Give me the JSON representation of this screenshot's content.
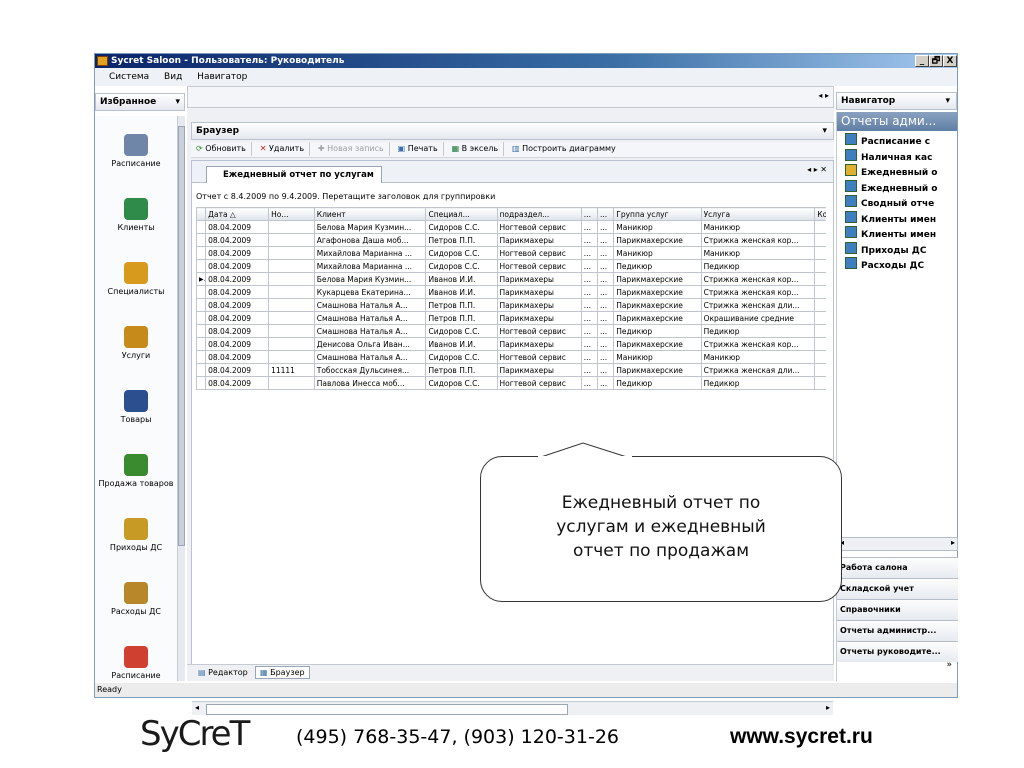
{
  "window": {
    "title": "Sycret Saloon - Пользователь: Руководитель",
    "controls": [
      "_",
      "🗗",
      "X"
    ]
  },
  "menu": [
    "Система",
    "Вид",
    "Навигатор"
  ],
  "favorites": {
    "header": "Избранное"
  },
  "left_nav": [
    {
      "label": "Расписание",
      "icon": "calendar-clock-icon"
    },
    {
      "label": "Клиенты",
      "icon": "client-card-icon"
    },
    {
      "label": "Специалисты",
      "icon": "people-icon"
    },
    {
      "label": "Услуги",
      "icon": "services-book-icon"
    },
    {
      "label": "Товары",
      "icon": "goods-pyramid-icon"
    },
    {
      "label": "Продажа товаров",
      "icon": "sale-person-icon"
    },
    {
      "label": "Приходы ДС",
      "icon": "money-bag-icon"
    },
    {
      "label": "Расходы ДС",
      "icon": "money-bag-out-icon"
    },
    {
      "label": "Расписание",
      "icon": "calendar-12-icon"
    }
  ],
  "browser": {
    "header": "Браузер",
    "toolbar": [
      "Обновить",
      "Удалить",
      "Новая запись",
      "Печать",
      "В эксель",
      "Построить диаграмму"
    ],
    "tab": "Ежедневный отчет по услугам",
    "info": "Отчет с 8.4.2009 по 9.4.2009. Перетащите заголовок для группировки",
    "columns": [
      "Дата  △",
      "Но...",
      "Клиент",
      "Специал...",
      "подраздел...",
      "...",
      "...",
      "Группа услуг",
      "Услуга",
      "Кол-в"
    ],
    "rows": [
      [
        "08.04.2009",
        "",
        "Белова Мария Кузмин...",
        "Сидоров С.С.",
        "Ногтевой сервис",
        "...",
        "...",
        "Маникюр",
        "Маникюр",
        ""
      ],
      [
        "08.04.2009",
        "",
        "Агафонова Даша моб...",
        "Петров П.П.",
        "Парикмахеры",
        "...",
        "...",
        "Парикмахерские",
        "Стрижка женская кор...",
        ""
      ],
      [
        "08.04.2009",
        "",
        "Михайлова Марианна ...",
        "Сидоров С.С.",
        "Ногтевой сервис",
        "...",
        "...",
        "Маникюр",
        "Маникюр",
        ""
      ],
      [
        "08.04.2009",
        "",
        "Михайлова Марианна ...",
        "Сидоров С.С.",
        "Ногтевой сервис",
        "...",
        "...",
        "Педикюр",
        "Педикюр",
        ""
      ],
      [
        "08.04.2009",
        "",
        "Белова Мария Кузмин...",
        "Иванов И.И.",
        "Парикмахеры",
        "...",
        "...",
        "Парикмахерские",
        "Стрижка женская кор...",
        ""
      ],
      [
        "08.04.2009",
        "",
        "Кукарцева Екатерина...",
        "Иванов И.И.",
        "Парикмахеры",
        "...",
        "...",
        "Парикмахерские",
        "Стрижка женская кор...",
        ""
      ],
      [
        "08.04.2009",
        "",
        "Смашнова Наталья А...",
        "Петров П.П.",
        "Парикмахеры",
        "...",
        "...",
        "Парикмахерские",
        "Стрижка женская дли...",
        ""
      ],
      [
        "08.04.2009",
        "",
        "Смашнова Наталья А...",
        "Петров П.П.",
        "Парикмахеры",
        "...",
        "...",
        "Парикмахерские",
        "Окрашивание средние",
        ""
      ],
      [
        "08.04.2009",
        "",
        "Смашнова Наталья А...",
        "Сидоров С.С.",
        "Ногтевой сервис",
        "...",
        "...",
        "Педикюр",
        "Педикюр",
        ""
      ],
      [
        "08.04.2009",
        "",
        "Денисова Ольга Иван...",
        "Иванов И.И.",
        "Парикмахеры",
        "...",
        "...",
        "Парикмахерские",
        "Стрижка женская кор...",
        ""
      ],
      [
        "08.04.2009",
        "",
        "Смашнова Наталья А...",
        "Сидоров С.С.",
        "Ногтевой сервис",
        "...",
        "...",
        "Маникюр",
        "Маникюр",
        ""
      ],
      [
        "08.04.2009",
        "11111",
        "Тобосская Дульсинея...",
        "Петров П.П.",
        "Парикмахеры",
        "...",
        "...",
        "Парикмахерские",
        "Стрижка женская дли...",
        ""
      ],
      [
        "08.04.2009",
        "",
        "Павлова Инесса моб...",
        "Сидоров С.С.",
        "Ногтевой сервис",
        "...",
        "...",
        "Педикюр",
        "Педикюр",
        ""
      ]
    ],
    "current_row": 4,
    "bottom_tabs": [
      "Редактор",
      "Браузер"
    ]
  },
  "navigator": {
    "header": "Навигатор",
    "section": "Отчеты адми...",
    "items": [
      "Расписание с",
      "Наличная кас",
      "Ежедневный о",
      "Ежедневный о",
      "Сводный отче",
      "Клиенты имен",
      "Клиенты имен",
      "Приходы ДС",
      "Расходы ДС"
    ],
    "groups": [
      "Работа салона",
      "Складской учет",
      "Справочники",
      "Отчеты администр...",
      "Отчеты руководите..."
    ]
  },
  "status": "Ready",
  "callout": {
    "lines": [
      "Ежедневный отчет по",
      "услугам и ежедневный",
      "отчет по продажам"
    ]
  },
  "footer": {
    "logo": "SyCreT",
    "phones": "(495) 768-35-47, (903) 120-31-26",
    "site": "www.sycret.ru"
  },
  "colors": {
    "titlebar": "#0a246a",
    "accent": "#3a6ea5",
    "logo": "#1a1a1a"
  }
}
